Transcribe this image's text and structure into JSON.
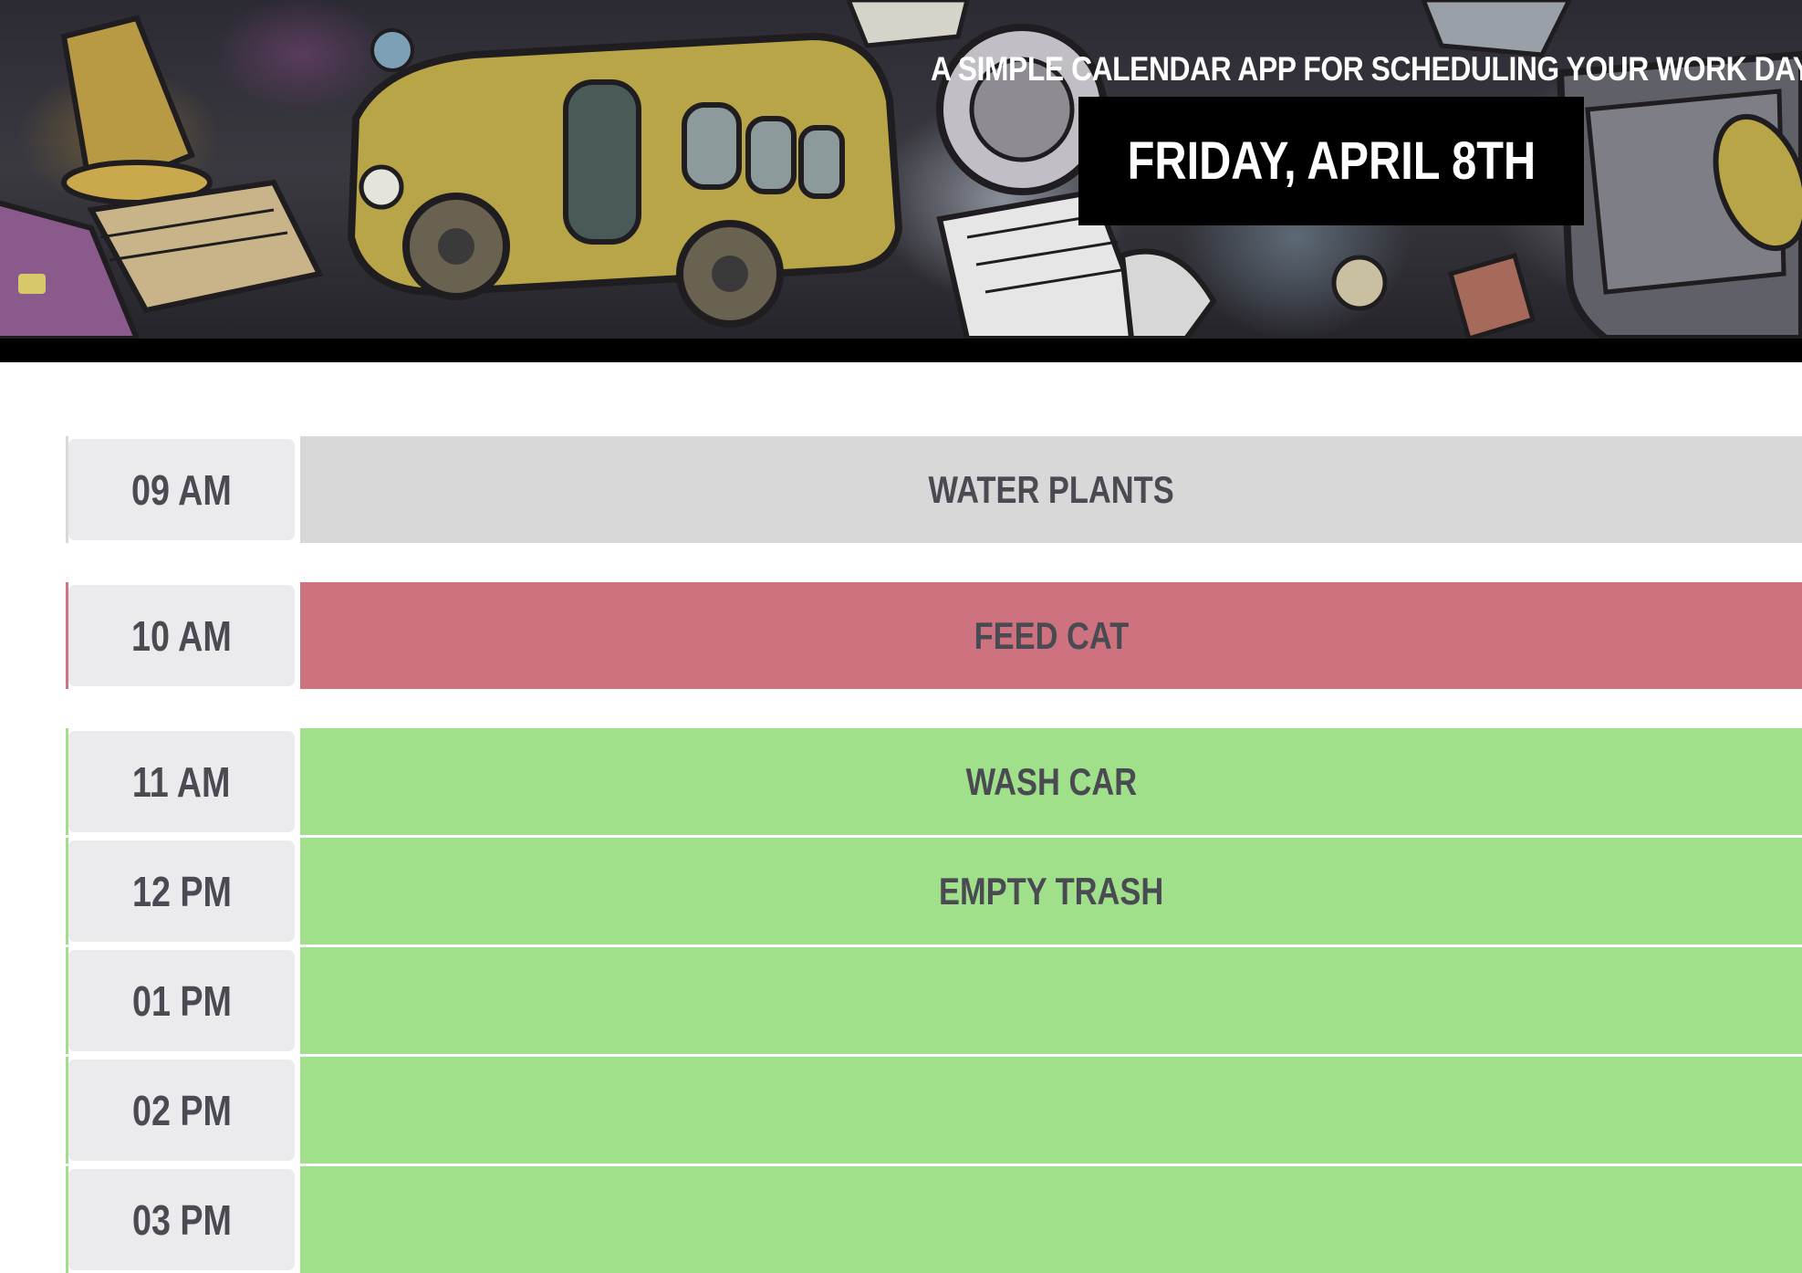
{
  "header": {
    "tagline": "A simple calendar app for scheduling your work day",
    "date": "Friday, April 8th"
  },
  "colors": {
    "past": "#d8d8d8",
    "present": "#cf727f",
    "future": "#a0e08b",
    "hour_bg": "#ebebee",
    "text": "#4a4b52",
    "header_bar": "#000000"
  },
  "schedule": [
    {
      "hour": "09 AM",
      "task": "Water plants",
      "state": "past"
    },
    {
      "hour": "10 AM",
      "task": "Feed cat",
      "state": "present"
    },
    {
      "hour": "11 AM",
      "task": "Wash car",
      "state": "future"
    },
    {
      "hour": "12 PM",
      "task": "Empty trash",
      "state": "future"
    },
    {
      "hour": "01 PM",
      "task": "",
      "state": "future"
    },
    {
      "hour": "02 PM",
      "task": "",
      "state": "future"
    },
    {
      "hour": "03 PM",
      "task": "",
      "state": "future"
    }
  ]
}
